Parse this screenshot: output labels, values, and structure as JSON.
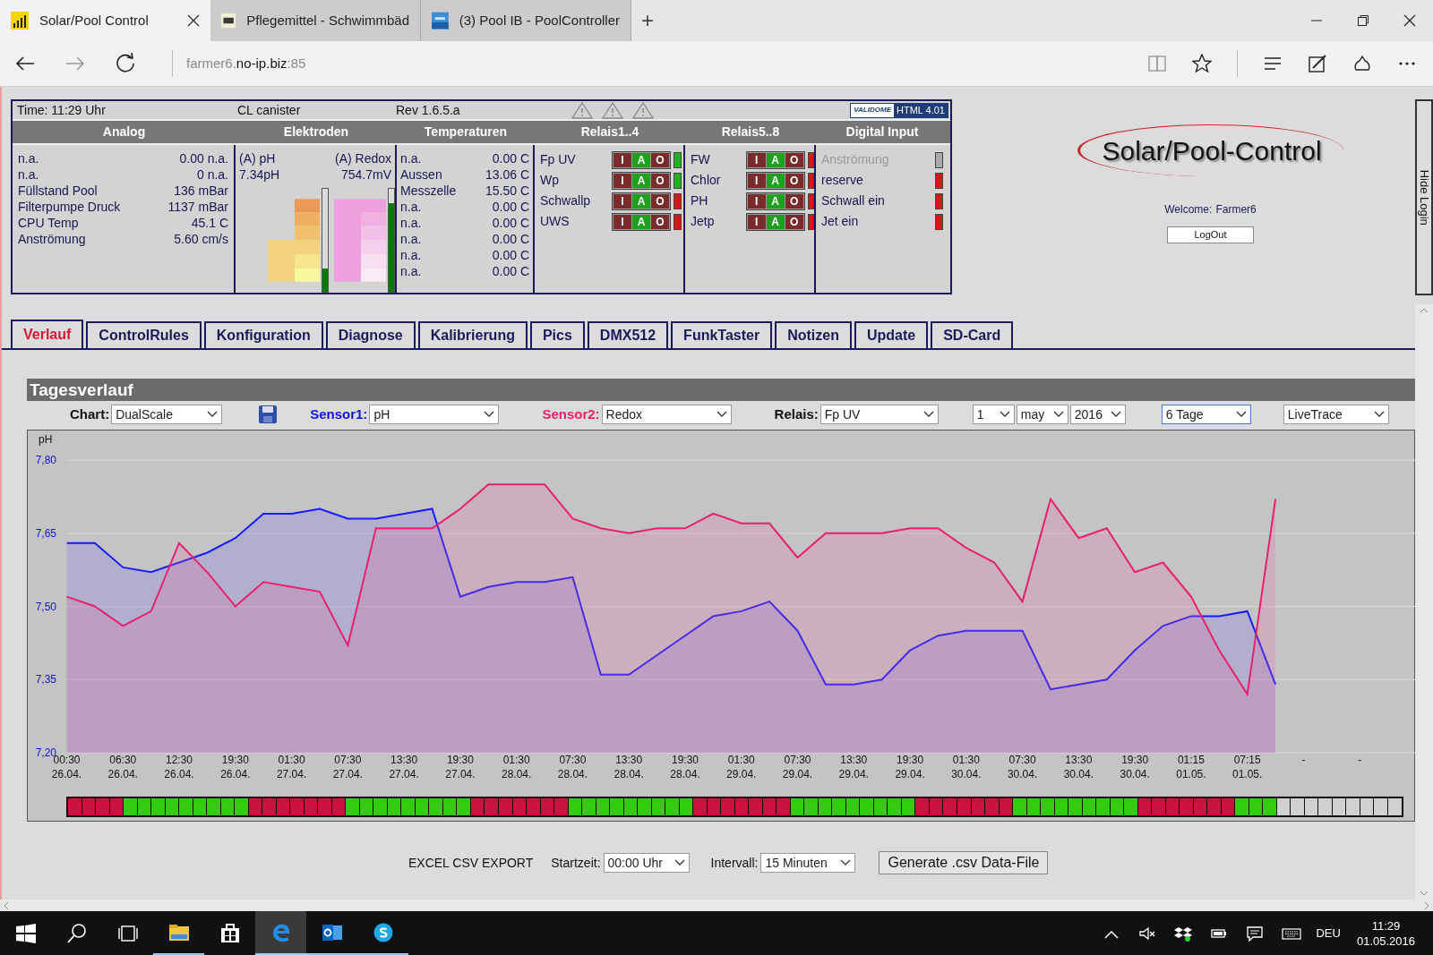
{
  "browser": {
    "tabs": [
      {
        "title": "Solar/Pool Control",
        "selected": true
      },
      {
        "title": "Pflegemittel - Schwimmbäd",
        "selected": false
      },
      {
        "title": "(3) Pool IB - PoolController",
        "selected": false
      }
    ],
    "new_tab": "+",
    "address": {
      "prefix": "farmer6.",
      "host": "no-ip.biz",
      "port": ":85"
    }
  },
  "status_panel": {
    "time": "Time: 11:29 Uhr",
    "device": "CL canister",
    "revision": "Rev 1.6.5.a",
    "badge_logo": "VALIDOME",
    "badge": "HTML 4.01",
    "headings": [
      "Analog",
      "Elektroden",
      "Temperaturen",
      "Relais1..4",
      "Relais5..8",
      "Digital Input"
    ],
    "analog": [
      {
        "label": "n.a.",
        "value": "0.00 n.a."
      },
      {
        "label": "n.a.",
        "value": "0 n.a."
      },
      {
        "label": "Füllstand Pool",
        "value": "136 mBar"
      },
      {
        "label": "Filterpumpe Druck",
        "value": "1137 mBar"
      },
      {
        "label": "CPU Temp",
        "value": "45.1 C"
      },
      {
        "label": "Anströmung",
        "value": "5.60 cm/s"
      }
    ],
    "electrodes": [
      {
        "kind": "ph",
        "title": "(A) pH",
        "reading": "7.34pH",
        "level": 0.23
      },
      {
        "kind": "redox",
        "title": "(A) Redox",
        "reading": "754.7mV",
        "level": 0.86
      }
    ],
    "temperatures": [
      {
        "label": "n.a.",
        "value": "0.00 C"
      },
      {
        "label": "Aussen",
        "value": "13.06 C"
      },
      {
        "label": "Messzelle",
        "value": "15.50 C"
      },
      {
        "label": "n.a.",
        "value": "0.00 C"
      },
      {
        "label": "n.a.",
        "value": "0.00 C"
      },
      {
        "label": "n.a.",
        "value": "0.00 C"
      },
      {
        "label": "n.a.",
        "value": "0.00 C"
      },
      {
        "label": "n.a.",
        "value": "0.00 C"
      }
    ],
    "relays_1_4": [
      {
        "name": "Fp UV",
        "on": true,
        "buttons": [
          {
            "label": "I",
            "selected": false
          },
          {
            "label": "A",
            "selected": true
          },
          {
            "label": "O",
            "selected": false
          }
        ]
      },
      {
        "name": "Wp",
        "on": true,
        "buttons": [
          {
            "label": "I",
            "selected": false
          },
          {
            "label": "A",
            "selected": true
          },
          {
            "label": "O",
            "selected": false
          }
        ]
      },
      {
        "name": "Schwallp",
        "on": false,
        "buttons": [
          {
            "label": "I",
            "selected": false
          },
          {
            "label": "A",
            "selected": true
          },
          {
            "label": "O",
            "selected": false
          }
        ]
      },
      {
        "name": "UWS",
        "on": false,
        "buttons": [
          {
            "label": "I",
            "selected": false
          },
          {
            "label": "A",
            "selected": true
          },
          {
            "label": "O",
            "selected": false
          }
        ]
      }
    ],
    "relays_5_8": [
      {
        "name": "FW",
        "on": false,
        "buttons": [
          {
            "label": "I",
            "selected": false
          },
          {
            "label": "A",
            "selected": true
          },
          {
            "label": "O",
            "selected": false
          }
        ]
      },
      {
        "name": "Chlor",
        "on": false,
        "buttons": [
          {
            "label": "I",
            "selected": false
          },
          {
            "label": "A",
            "selected": true
          },
          {
            "label": "O",
            "selected": false
          }
        ]
      },
      {
        "name": "PH",
        "on": false,
        "buttons": [
          {
            "label": "I",
            "selected": false
          },
          {
            "label": "A",
            "selected": true
          },
          {
            "label": "O",
            "selected": false
          }
        ]
      },
      {
        "name": "Jetp",
        "on": false,
        "buttons": [
          {
            "label": "I",
            "selected": false
          },
          {
            "label": "A",
            "selected": true
          },
          {
            "label": "O",
            "selected": false
          }
        ]
      }
    ],
    "digital_inputs": [
      {
        "label": "Anströmung",
        "enabled": false,
        "on": false
      },
      {
        "label": "reserve",
        "enabled": true,
        "on": false
      },
      {
        "label": "Schwall ein",
        "enabled": true,
        "on": false
      },
      {
        "label": "Jet ein",
        "enabled": true,
        "on": false
      }
    ]
  },
  "login": {
    "logo": "Solar/Pool-Control",
    "welcome": "Welcome:",
    "user": "Farmer6",
    "logout": "LogOut",
    "hide_tab": "Hide Login"
  },
  "page_tabs": [
    {
      "label": "Verlauf",
      "selected": true
    },
    {
      "label": "ControlRules",
      "selected": false
    },
    {
      "label": "Konfiguration",
      "selected": false
    },
    {
      "label": "Diagnose",
      "selected": false
    },
    {
      "label": "Kalibrierung",
      "selected": false
    },
    {
      "label": "Pics",
      "selected": false
    },
    {
      "label": "DMX512",
      "selected": false
    },
    {
      "label": "FunkTaster",
      "selected": false
    },
    {
      "label": "Notizen",
      "selected": false
    },
    {
      "label": "Update",
      "selected": false
    },
    {
      "label": "SD-Card",
      "selected": false
    }
  ],
  "tagesverlauf": {
    "title": "Tagesverlauf",
    "controls": [
      {
        "kind": "chart",
        "label": "Chart:",
        "value": "DualScale"
      },
      {
        "kind": "sensor1",
        "label": "Sensor1:",
        "value": "pH"
      },
      {
        "kind": "sensor2",
        "label": "Sensor2:",
        "value": "Redox"
      },
      {
        "kind": "relais",
        "label": "Relais:",
        "value": "Fp UV"
      }
    ],
    "date": [
      {
        "value": "1"
      },
      {
        "value": "may"
      },
      {
        "value": "2016"
      }
    ],
    "range": {
      "value": "6 Tage",
      "focused": true
    },
    "mode": {
      "value": "LiveTrace"
    },
    "chart_data": {
      "type": "area",
      "ylabel": "pH",
      "ylim": [
        7.2,
        7.8
      ],
      "grid": true,
      "yticks": [
        {
          "value": 7.2,
          "label": "7,20"
        },
        {
          "value": 7.35,
          "label": "7,35"
        },
        {
          "value": 7.5,
          "label": "7,50"
        },
        {
          "value": 7.65,
          "label": "7,65"
        },
        {
          "value": 7.8,
          "label": "7,80"
        }
      ],
      "categories": [
        "00:30 26.04.",
        null,
        "06:30 26.04.",
        null,
        "12:30 26.04.",
        null,
        "19:30 26.04.",
        null,
        "01:30 27.04.",
        null,
        "07:30 27.04.",
        null,
        "13:30 27.04.",
        null,
        "19:30 27.04.",
        null,
        "01:30 28.04.",
        null,
        "07:30 28.04.",
        null,
        "13:30 28.04.",
        null,
        "19:30 28.04.",
        null,
        "01:30 29.04.",
        null,
        "07:30 29.04.",
        null,
        "13:30 29.04.",
        null,
        "19:30 29.04.",
        null,
        "01:30 30.04.",
        null,
        "07:30 30.04.",
        null,
        "13:30 30.04.",
        null,
        "19:30 30.04.",
        null,
        "01:15 01.05.",
        null,
        "07:15 01.05.",
        null,
        "-",
        null,
        "-",
        null
      ],
      "series": [
        {
          "color": "#1a1aff",
          "values": [
            7.63,
            7.63,
            7.58,
            7.57,
            7.59,
            7.61,
            7.64,
            7.69,
            7.69,
            7.7,
            7.68,
            7.68,
            7.69,
            7.7,
            7.52,
            7.54,
            7.55,
            7.55,
            7.56,
            7.36,
            7.36,
            7.4,
            7.44,
            7.48,
            7.49,
            7.51,
            7.45,
            7.34,
            7.34,
            7.35,
            7.41,
            7.44,
            7.45,
            7.45,
            7.45,
            7.33,
            7.34,
            7.35,
            7.41,
            7.46,
            7.48,
            7.48,
            7.49,
            7.34,
            null,
            null,
            null,
            null
          ]
        },
        {
          "color": "#e8206e",
          "values": [
            7.52,
            7.5,
            7.46,
            7.49,
            7.63,
            7.57,
            7.5,
            7.55,
            7.54,
            7.53,
            7.42,
            7.66,
            7.66,
            7.66,
            7.7,
            7.75,
            7.75,
            7.75,
            7.68,
            7.66,
            7.65,
            7.66,
            7.66,
            7.69,
            7.67,
            7.67,
            7.6,
            7.65,
            7.65,
            7.65,
            7.66,
            7.66,
            7.62,
            7.59,
            7.51,
            7.72,
            7.64,
            7.66,
            7.57,
            7.59,
            7.52,
            7.41,
            7.32,
            7.72,
            null,
            null,
            null,
            null
          ]
        }
      ]
    },
    "relay_strip": [
      {
        "recorded": true,
        "on": false
      },
      {
        "recorded": true,
        "on": false
      },
      {
        "recorded": true,
        "on": false
      },
      {
        "recorded": true,
        "on": false
      },
      {
        "recorded": true,
        "on": true
      },
      {
        "recorded": true,
        "on": true
      },
      {
        "recorded": true,
        "on": true
      },
      {
        "recorded": true,
        "on": true
      },
      {
        "recorded": true,
        "on": true
      },
      {
        "recorded": true,
        "on": true
      },
      {
        "recorded": true,
        "on": true
      },
      {
        "recorded": true,
        "on": true
      },
      {
        "recorded": true,
        "on": true
      },
      {
        "recorded": true,
        "on": false
      },
      {
        "recorded": true,
        "on": false
      },
      {
        "recorded": true,
        "on": false
      },
      {
        "recorded": true,
        "on": false
      },
      {
        "recorded": true,
        "on": false
      },
      {
        "recorded": true,
        "on": false
      },
      {
        "recorded": true,
        "on": false
      },
      {
        "recorded": true,
        "on": true
      },
      {
        "recorded": true,
        "on": true
      },
      {
        "recorded": true,
        "on": true
      },
      {
        "recorded": true,
        "on": true
      },
      {
        "recorded": true,
        "on": true
      },
      {
        "recorded": true,
        "on": true
      },
      {
        "recorded": true,
        "on": true
      },
      {
        "recorded": true,
        "on": true
      },
      {
        "recorded": true,
        "on": true
      },
      {
        "recorded": true,
        "on": false
      },
      {
        "recorded": true,
        "on": false
      },
      {
        "recorded": true,
        "on": false
      },
      {
        "recorded": true,
        "on": false
      },
      {
        "recorded": true,
        "on": false
      },
      {
        "recorded": true,
        "on": false
      },
      {
        "recorded": true,
        "on": false
      },
      {
        "recorded": true,
        "on": true
      },
      {
        "recorded": true,
        "on": true
      },
      {
        "recorded": true,
        "on": true
      },
      {
        "recorded": true,
        "on": true
      },
      {
        "recorded": true,
        "on": true
      },
      {
        "recorded": true,
        "on": true
      },
      {
        "recorded": true,
        "on": true
      },
      {
        "recorded": true,
        "on": true
      },
      {
        "recorded": true,
        "on": true
      },
      {
        "recorded": true,
        "on": false
      },
      {
        "recorded": true,
        "on": false
      },
      {
        "recorded": true,
        "on": false
      },
      {
        "recorded": true,
        "on": false
      },
      {
        "recorded": true,
        "on": false
      },
      {
        "recorded": true,
        "on": false
      },
      {
        "recorded": true,
        "on": false
      },
      {
        "recorded": true,
        "on": true
      },
      {
        "recorded": true,
        "on": true
      },
      {
        "recorded": true,
        "on": true
      },
      {
        "recorded": true,
        "on": true
      },
      {
        "recorded": true,
        "on": true
      },
      {
        "recorded": true,
        "on": true
      },
      {
        "recorded": true,
        "on": true
      },
      {
        "recorded": true,
        "on": true
      },
      {
        "recorded": true,
        "on": true
      },
      {
        "recorded": true,
        "on": false
      },
      {
        "recorded": true,
        "on": false
      },
      {
        "recorded": true,
        "on": false
      },
      {
        "recorded": true,
        "on": false
      },
      {
        "recorded": true,
        "on": false
      },
      {
        "recorded": true,
        "on": false
      },
      {
        "recorded": true,
        "on": false
      },
      {
        "recorded": true,
        "on": true
      },
      {
        "recorded": true,
        "on": true
      },
      {
        "recorded": true,
        "on": true
      },
      {
        "recorded": true,
        "on": true
      },
      {
        "recorded": true,
        "on": true
      },
      {
        "recorded": true,
        "on": true
      },
      {
        "recorded": true,
        "on": true
      },
      {
        "recorded": true,
        "on": true
      },
      {
        "recorded": true,
        "on": true
      },
      {
        "recorded": true,
        "on": false
      },
      {
        "recorded": true,
        "on": false
      },
      {
        "recorded": true,
        "on": false
      },
      {
        "recorded": true,
        "on": false
      },
      {
        "recorded": true,
        "on": false
      },
      {
        "recorded": true,
        "on": false
      },
      {
        "recorded": true,
        "on": false
      },
      {
        "recorded": true,
        "on": true
      },
      {
        "recorded": true,
        "on": true
      },
      {
        "recorded": true,
        "on": true
      },
      {
        "recorded": false,
        "on": false
      },
      {
        "recorded": false,
        "on": false
      },
      {
        "recorded": false,
        "on": false
      },
      {
        "recorded": false,
        "on": false
      },
      {
        "recorded": false,
        "on": false
      },
      {
        "recorded": false,
        "on": false
      },
      {
        "recorded": false,
        "on": false
      },
      {
        "recorded": false,
        "on": false
      },
      {
        "recorded": false,
        "on": false
      }
    ]
  },
  "export": {
    "title": "EXCEL CSV EXPORT",
    "start_label": "Startzeit:",
    "start_value": "00:00 Uhr",
    "interval_label": "Intervall:",
    "interval_value": "15 Minuten",
    "button": "Generate .csv Data-File"
  },
  "taskbar": {
    "apps": [
      {
        "kind": "explorer",
        "open": true,
        "active": false
      },
      {
        "kind": "store",
        "open": false,
        "active": false
      },
      {
        "kind": "edge",
        "open": true,
        "active": true
      },
      {
        "kind": "outlook",
        "open": true,
        "active": false
      },
      {
        "kind": "skype",
        "open": true,
        "active": false
      }
    ],
    "language": "DEU",
    "time": "11:29",
    "date": "01.05.2016"
  }
}
